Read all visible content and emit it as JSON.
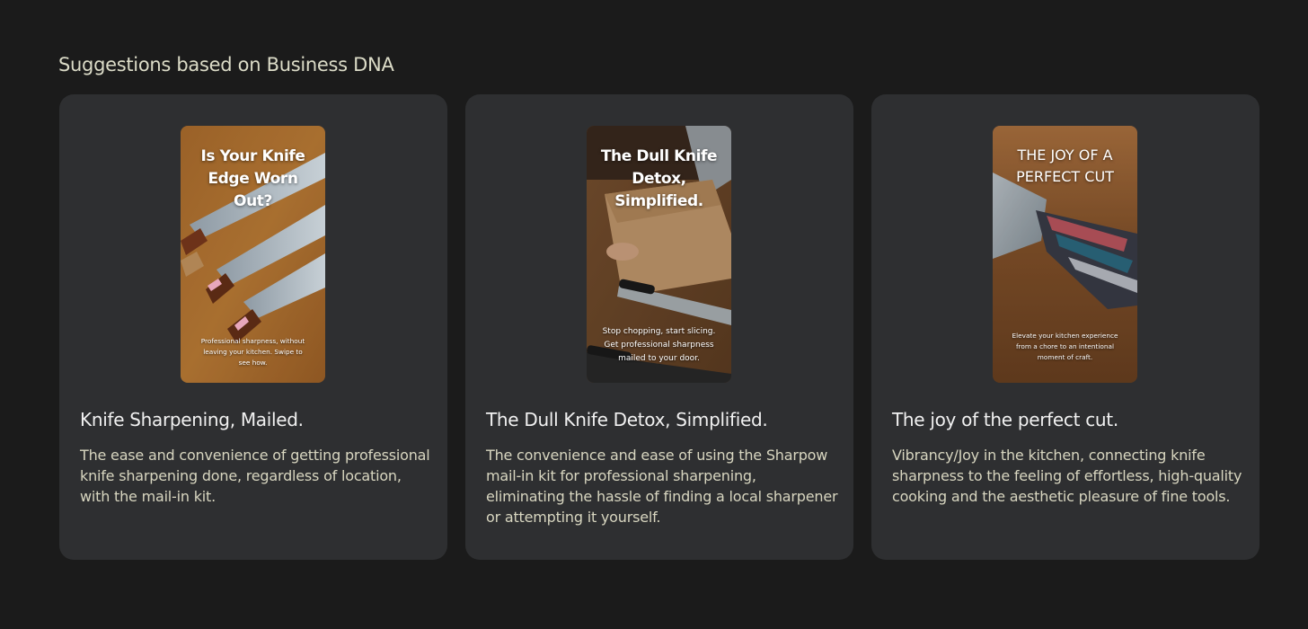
{
  "section": {
    "title": "Suggestions based on Business DNA"
  },
  "cards": [
    {
      "title": "Knife Sharpening, Mailed.",
      "description": "The ease and convenience of getting professional knife sharpening done, regardless of location, with the mail-in kit.",
      "thumbnail": {
        "headline": "Is Your Knife\nEdge Worn\nOut?",
        "subtext": "Professional sharpness, without\nleaving your kitchen. Swipe to\nsee how."
      }
    },
    {
      "title": "The Dull Knife Detox, Simplified.",
      "description": "The convenience and ease of using the Sharpow mail-in kit for professional sharpening, eliminating the hassle of finding a local sharpener or attempting it yourself.",
      "thumbnail": {
        "headline": "The Dull Knife\nDetox,\nSimplified.",
        "subtext": "Stop chopping, start slicing.\nGet professional sharpness\nmailed to your door."
      }
    },
    {
      "title": "The joy of the perfect cut.",
      "description": "Vibrancy/Joy in the kitchen, connecting knife sharpness to the feeling of effortless, high-quality cooking and the aesthetic pleasure of fine tools.",
      "thumbnail": {
        "headline": "THE JOY OF A\nPERFECT CUT",
        "subtext": "Elevate your kitchen experience\nfrom a chore to an intentional\nmoment of craft."
      }
    }
  ]
}
